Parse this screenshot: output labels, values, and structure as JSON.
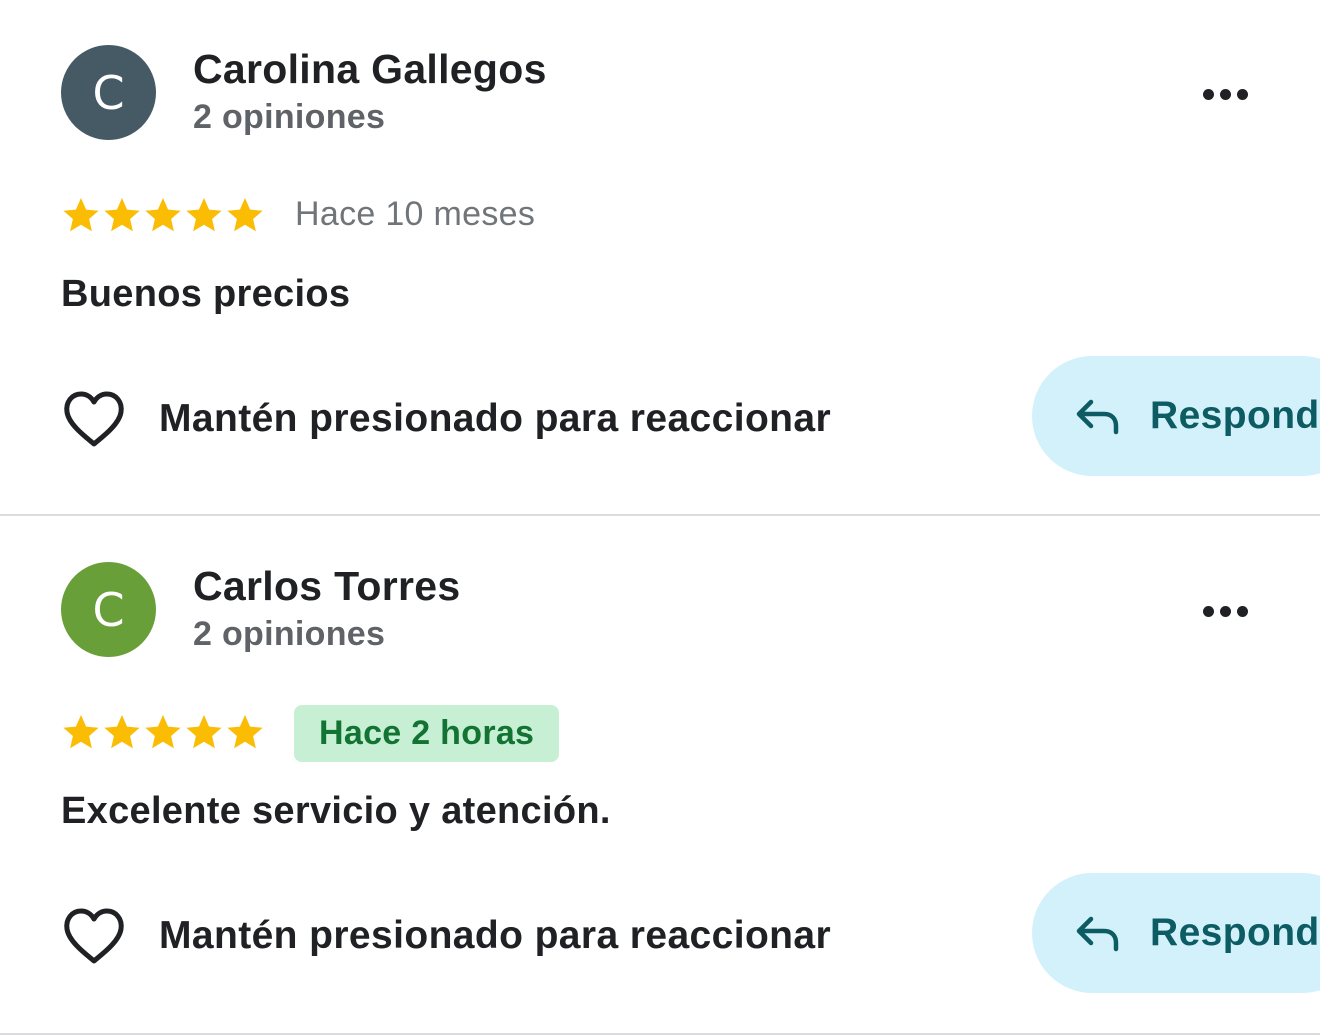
{
  "reviews": [
    {
      "initial": "C",
      "avatar_color": "#455a64",
      "name": "Carolina Gallegos",
      "count": "2 opiniones",
      "rating": 5,
      "time": "Hace 10 meses",
      "time_highlighted": false,
      "text": "Buenos precios",
      "react_label": "Mantén presionado para reaccionar",
      "reply_label": "Respond"
    },
    {
      "initial": "C",
      "avatar_color": "#689f38",
      "name": "Carlos Torres",
      "count": "2 opiniones",
      "rating": 5,
      "time": "Hace 2 horas",
      "time_highlighted": true,
      "text": "Excelente servicio y atención.",
      "react_label": "Mantén presionado para reaccionar",
      "reply_label": "Respond"
    }
  ],
  "icons": {
    "more": "more-options-icon",
    "star": "star-icon",
    "heart": "heart-outline-icon",
    "reply": "reply-arrow-icon"
  },
  "colors": {
    "star": "#fbbc04",
    "badge_bg": "#c6efd4",
    "badge_text": "#137333",
    "reply_bg": "#d3f1fb",
    "reply_text": "#0d5c63"
  }
}
